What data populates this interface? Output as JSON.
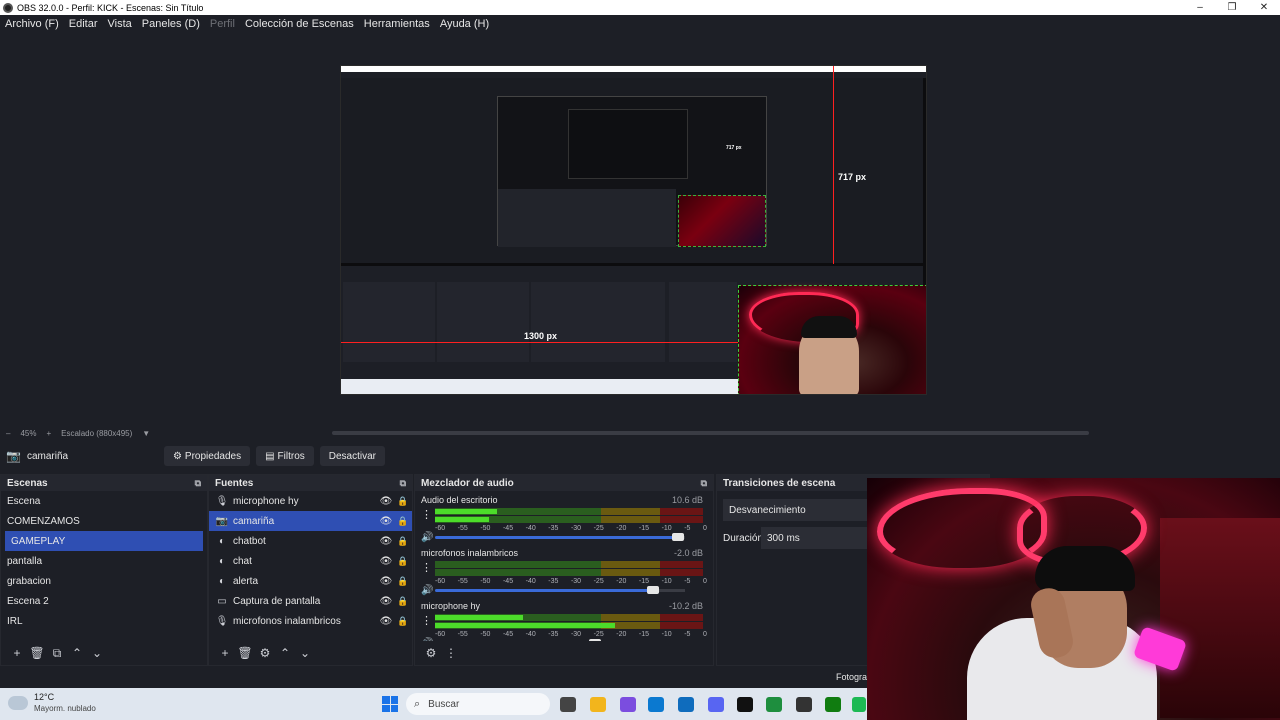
{
  "window": {
    "title": "OBS 32.0.0 - Perfil: KICK - Escenas: Sin Título",
    "controls": {
      "minimize": "–",
      "maximize": "❐",
      "close": "✕"
    }
  },
  "menu": [
    {
      "label": "Archivo (F)",
      "enabled": true
    },
    {
      "label": "Editar",
      "enabled": true
    },
    {
      "label": "Vista",
      "enabled": true
    },
    {
      "label": "Paneles (D)",
      "enabled": true
    },
    {
      "label": "Perfil",
      "enabled": false
    },
    {
      "label": "Colección de Escenas",
      "enabled": true
    },
    {
      "label": "Herramientas",
      "enabled": true
    },
    {
      "label": "Ayuda (H)",
      "enabled": true
    }
  ],
  "preview": {
    "guide_vertical_label": "717 px",
    "guide_horizontal_label": "1300 px",
    "nested_label": "717 px"
  },
  "zoom": {
    "minus": "–",
    "percent": "45%",
    "plus": "+",
    "mode": "Escalado (880x495)",
    "dropdown": "▼"
  },
  "source_toolbar": {
    "selected_source": "camariña",
    "properties": "Propiedades",
    "filters": "Filtros",
    "deactivate": "Desactivar"
  },
  "scenes": {
    "title": "Escenas",
    "items": [
      "Escena",
      "COMENZAMOS",
      "GAMEPLAY",
      "pantalla",
      "grabacion",
      "Escena 2",
      "IRL"
    ],
    "selected": "GAMEPLAY",
    "footer": [
      "+",
      "🗑",
      "⧉",
      "⌃",
      "⌄"
    ]
  },
  "sources": {
    "title": "Fuentes",
    "items": [
      {
        "label": "microphone hy",
        "icon": "mic-icon",
        "glyph": "🎙"
      },
      {
        "label": "camariña",
        "icon": "camera-icon",
        "glyph": "📷"
      },
      {
        "label": "chatbot",
        "icon": "browser-icon",
        "glyph": "◐"
      },
      {
        "label": "chat",
        "icon": "browser-icon",
        "glyph": "◐"
      },
      {
        "label": "alerta",
        "icon": "browser-icon",
        "glyph": "◐"
      },
      {
        "label": "Captura de pantalla",
        "icon": "monitor-icon",
        "glyph": "▭"
      },
      {
        "label": "microfonos inalambricos",
        "icon": "mic-icon",
        "glyph": "🎙"
      }
    ],
    "selected": "camariña",
    "footer": [
      "+",
      "🗑",
      "⚙",
      "⌃",
      "⌄"
    ]
  },
  "mixer": {
    "title": "Mezclador de audio",
    "scale": [
      "-60",
      "-55",
      "-50",
      "-45",
      "-40",
      "-35",
      "-30",
      "-25",
      "-20",
      "-15",
      "-10",
      "-5",
      "0"
    ],
    "channels": [
      {
        "name": "Audio del escritorio",
        "db": "10.6 dB",
        "level1": 0.23,
        "level2": 0.2,
        "volume": 0.97
      },
      {
        "name": "microfonos inalambricos",
        "db": "-2.0 dB",
        "level1": 0.0,
        "level2": 0.0,
        "volume": 0.87
      },
      {
        "name": "microphone hy",
        "db": "-10.2 dB",
        "level1": 0.33,
        "level2": 0.67,
        "volume": 0.64
      }
    ],
    "footer": [
      "⚙",
      "⋮"
    ]
  },
  "transitions": {
    "title": "Transiciones de escena",
    "type": "Desvanecimiento",
    "duration_label": "Duración",
    "duration_value": "300 ms"
  },
  "overlay": {
    "partial_label": "Fotogra"
  },
  "taskbar": {
    "temperature": "12°C",
    "condition": "Mayorm. nublado",
    "search_placeholder": "Buscar",
    "search_icon": "⌕"
  },
  "colors": {
    "bg": "#1d1f26",
    "selection": "#2f4fb3",
    "meter_green": "#4cdc2a",
    "guide_red": "#ff2020"
  }
}
